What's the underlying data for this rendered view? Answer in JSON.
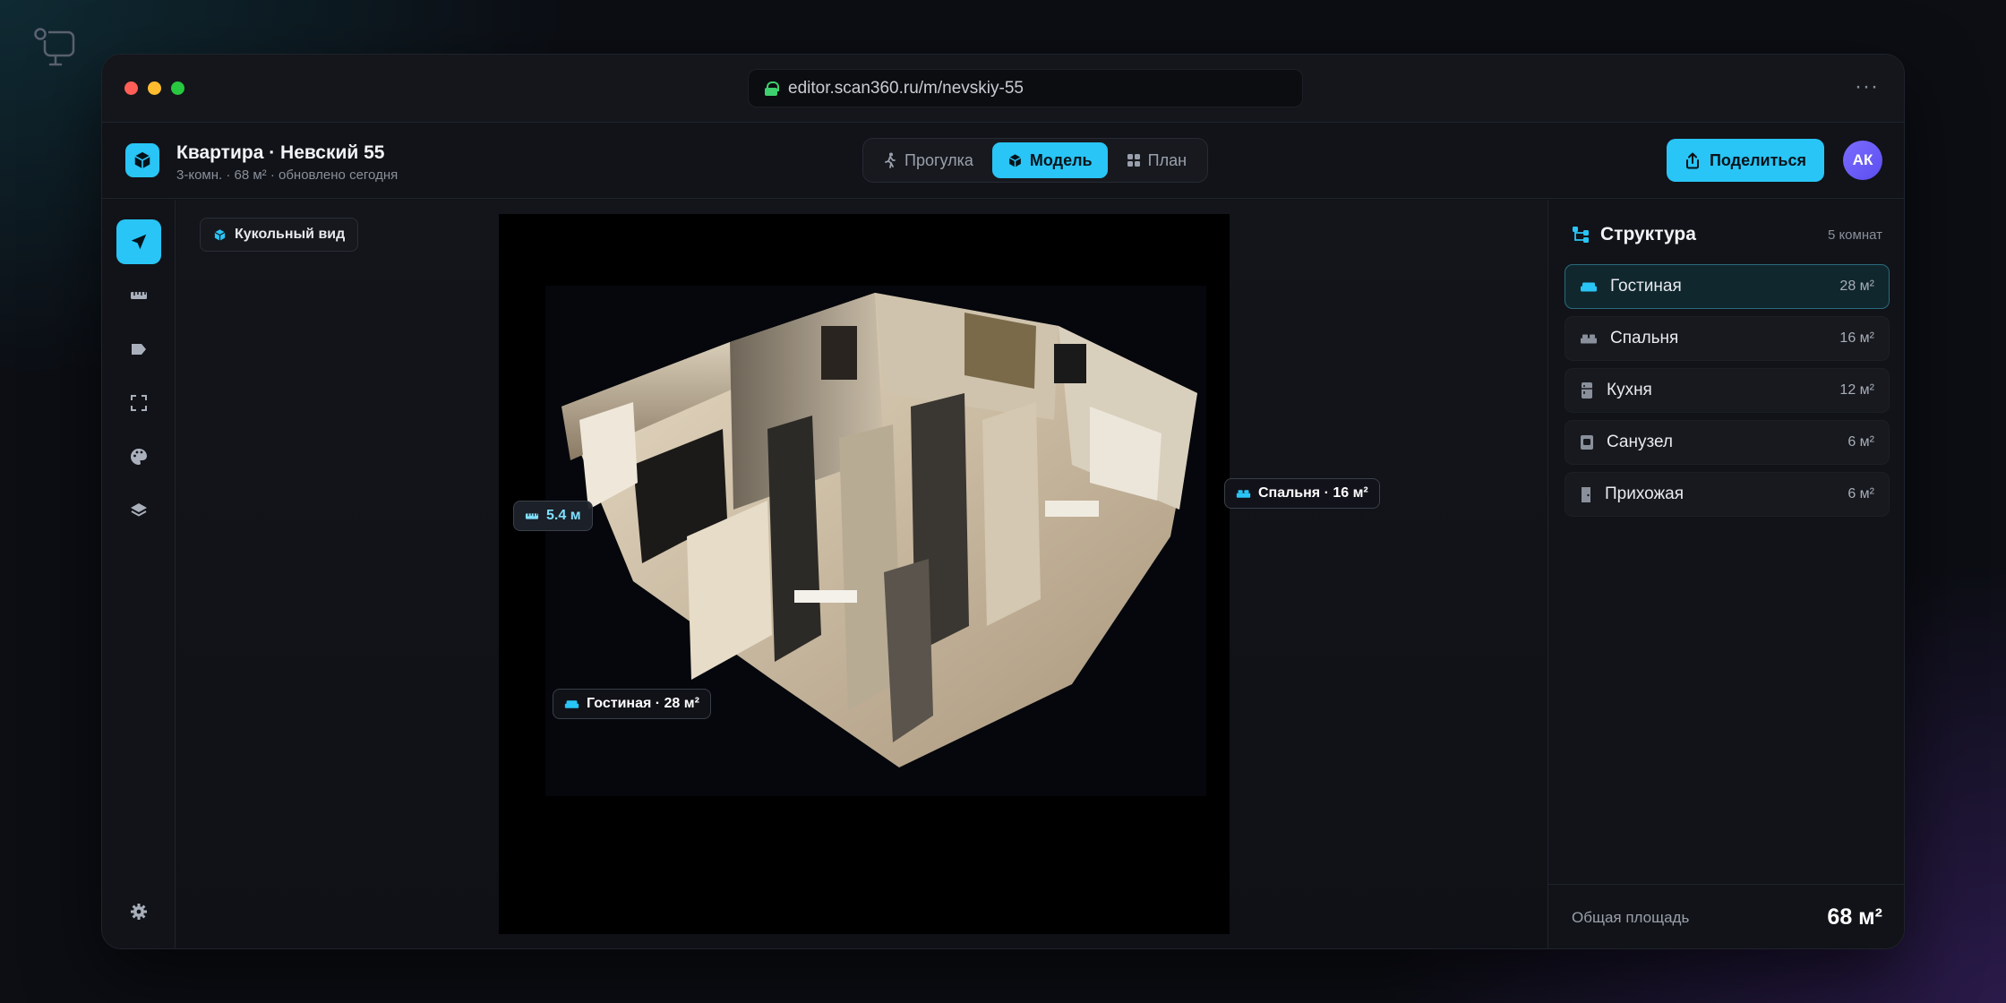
{
  "browser": {
    "url": "editor.scan360.ru/m/nevskiy-55",
    "more_label": "···"
  },
  "header": {
    "title": "Квартира · Невский 55",
    "subtitle": "3-комн. · 68 м² · обновлено сегодня",
    "tabs": [
      {
        "label": "Прогулка",
        "icon": "walk-icon",
        "active": false
      },
      {
        "label": "Модель",
        "icon": "cube-icon",
        "active": true
      },
      {
        "label": "План",
        "icon": "grid-icon",
        "active": false
      }
    ],
    "share_label": "Поделиться",
    "avatar_initials": "АК"
  },
  "tools": [
    {
      "icon": "navigate-icon",
      "active": true
    },
    {
      "icon": "ruler-icon",
      "active": false
    },
    {
      "icon": "tag-icon",
      "active": false
    },
    {
      "icon": "fullscreen-icon",
      "active": false
    },
    {
      "icon": "palette-icon",
      "active": false
    },
    {
      "icon": "layers-icon",
      "active": false
    },
    {
      "icon": "settings-icon",
      "active": false
    }
  ],
  "viewport": {
    "mode_label": "Кукольный вид",
    "tags": {
      "measure": "5.4 м",
      "bedroom": "Спальня · 16 м²",
      "living": "Гостиная · 28 м²"
    },
    "zoom_in": "+",
    "zoom_out": "−"
  },
  "panel": {
    "title": "Структура",
    "count": "5 комнат",
    "rooms": [
      {
        "name": "Гостиная",
        "area": "28 м²",
        "icon": "sofa-icon",
        "active": true
      },
      {
        "name": "Спальня",
        "area": "16 м²",
        "icon": "bed-icon",
        "active": false
      },
      {
        "name": "Кухня",
        "area": "12 м²",
        "icon": "fridge-icon",
        "active": false
      },
      {
        "name": "Санузел",
        "area": "6 м²",
        "icon": "bath-icon",
        "active": false
      },
      {
        "name": "Прихожая",
        "area": "6 м²",
        "icon": "door-icon",
        "active": false
      }
    ],
    "total_label": "Общая площадь",
    "total_value": "68 м²"
  },
  "colors": {
    "accent": "#29c5f6",
    "avatar": "#6b5cf6",
    "window_bg": "#111318"
  }
}
